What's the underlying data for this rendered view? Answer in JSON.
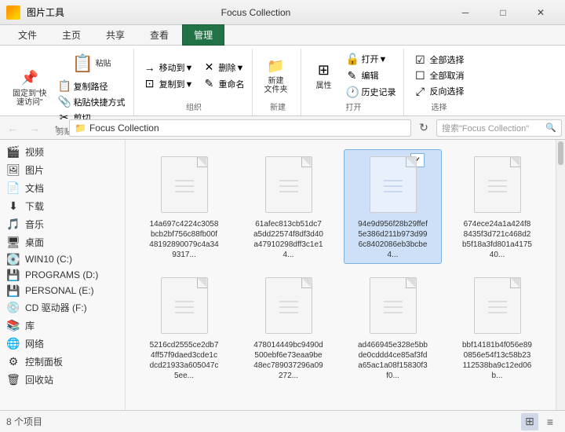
{
  "titleBar": {
    "appName": "图片工具",
    "windowTitle": "Focus Collection",
    "controls": {
      "minimize": "─",
      "maximize": "□",
      "close": "✕"
    }
  },
  "ribbonTabs": [
    {
      "label": "文件",
      "active": false
    },
    {
      "label": "主页",
      "active": false
    },
    {
      "label": "共享",
      "active": false
    },
    {
      "label": "查看",
      "active": false
    },
    {
      "label": "管理",
      "active": true,
      "highlight": true
    }
  ],
  "ribbonGroups": [
    {
      "name": "剪贴板",
      "buttons": [
        {
          "icon": "📌",
          "label": "固定到\"快\n速访问\""
        },
        {
          "icon": "📋",
          "label": "粘贴"
        },
        {
          "icon": "✂️",
          "label": "剪切"
        }
      ],
      "smallButtons": [
        {
          "icon": "📋",
          "label": "复制路径"
        },
        {
          "icon": "📎",
          "label": "粘贴快捷方式"
        }
      ]
    },
    {
      "name": "组织",
      "buttons": [
        {
          "icon": "→",
          "label": "移动到▼"
        },
        {
          "icon": "⊡",
          "label": "复制到▼"
        }
      ],
      "smallButtons": [
        {
          "icon": "✕",
          "label": "删除▼"
        },
        {
          "icon": "✎",
          "label": "重命名"
        }
      ]
    },
    {
      "name": "新建",
      "buttons": [
        {
          "icon": "📁",
          "label": "新建\n文件夹"
        }
      ],
      "smallButtons": []
    },
    {
      "name": "打开",
      "buttons": [
        {
          "icon": "⊞",
          "label": "属性"
        },
        {
          "icon": "🔓",
          "label": "打开▼"
        },
        {
          "icon": "✎",
          "label": "编辑"
        },
        {
          "icon": "🕐",
          "label": "历史记录"
        }
      ],
      "smallButtons": []
    },
    {
      "name": "选择",
      "buttons": [],
      "smallButtons": [
        {
          "icon": "☑",
          "label": "全部选择"
        },
        {
          "icon": "☐",
          "label": "全部取消"
        },
        {
          "icon": "⤢",
          "label": "反向选择"
        }
      ]
    }
  ],
  "addressBar": {
    "back": "←",
    "forward": "→",
    "up": "↑",
    "path": "Focus Collection",
    "pathIcon": "📁",
    "searchPlaceholder": "搜索\"Focus Collection\""
  },
  "sidebar": {
    "items": [
      {
        "icon": "🎬",
        "label": "视频"
      },
      {
        "icon": "🖼️",
        "label": "图片"
      },
      {
        "icon": "📄",
        "label": "文档"
      },
      {
        "icon": "⬇️",
        "label": "下载"
      },
      {
        "icon": "🎵",
        "label": "音乐"
      },
      {
        "icon": "🖥️",
        "label": "桌面"
      },
      {
        "icon": "💽",
        "label": "WIN10 (C:)"
      },
      {
        "icon": "💾",
        "label": "PROGRAMS (D:)"
      },
      {
        "icon": "💾",
        "label": "PERSONAL (E:)"
      },
      {
        "icon": "💿",
        "label": "CD 驱动器 (F:)"
      },
      {
        "icon": "📚",
        "label": "库"
      },
      {
        "icon": "🌐",
        "label": "网络"
      },
      {
        "icon": "⚙️",
        "label": "控制面板"
      },
      {
        "icon": "🗑️",
        "label": "回收站"
      }
    ]
  },
  "files": [
    {
      "name": "14a697c4224c3058bcb2bf756c88fb00f48192890079c4a349317...",
      "selected": false
    },
    {
      "name": "61afec813cb51dc7a5dd22574f8df3d40a47910298dff3c1e14...",
      "selected": false
    },
    {
      "name": "94e9d956f28b29ffef5e386d211b973d996c8402086eb3bcbe4...",
      "selected": true
    },
    {
      "name": "674ece24a1a424f88435f3d721c468d2b5f18a3fd801a417540...",
      "selected": false
    },
    {
      "name": "5216cd2555ce2db74ff57f9daed3cde1cdcd21933a605047c5ee...",
      "selected": false
    },
    {
      "name": "478014449bc9490d500ebf6e73eaa9be48ec789037296a09272...",
      "selected": false
    },
    {
      "name": "ad466945e328e5bbde0cddd4ce85af3fda65ac1a08f15830f3f0...",
      "selected": false
    },
    {
      "name": "bbf14181b4f056e890856e54f13c58b23112538ba9c12ed06b...",
      "selected": false
    }
  ],
  "statusBar": {
    "count": "8 个项目",
    "viewGrid": "⊞",
    "viewList": "≡"
  }
}
